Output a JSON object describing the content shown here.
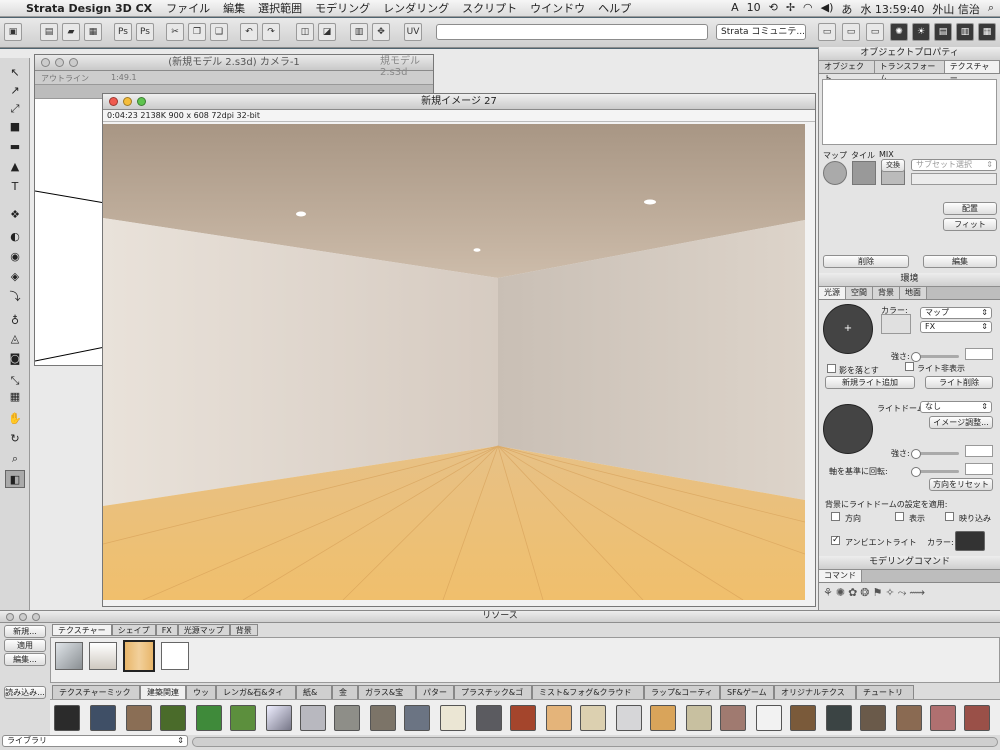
{
  "menubar": {
    "app_name": "Strata Design 3D CX",
    "items": [
      "ファイル",
      "編集",
      "選択範囲",
      "モデリング",
      "レンダリング",
      "スクリプト",
      "ウインドウ",
      "ヘルプ"
    ],
    "status_a": "10",
    "clock": "水 13:59:40",
    "user": "外山 信治"
  },
  "toolbar": {
    "community_label": "Strata コミュニテ..."
  },
  "model_window": {
    "title": "(新規モデル 2.s3d) カメラ-1",
    "behind_title": "規モデル 2.s3d",
    "outline_label": "アウトライン",
    "scale_label": "1:49.1"
  },
  "render_window": {
    "title": "新規イメージ 27",
    "info": "0:04:23   2138K   900 x 608   72dpi   32-bit"
  },
  "object_props": {
    "title": "オブジェクトプロパティ",
    "tabs": [
      "オブジェクト",
      "トランスフォーム",
      "テクスチャー"
    ],
    "labels": [
      "マップ",
      "タイル",
      "MIX"
    ],
    "swap_label": "交換",
    "subset_placeholder": "サブセット選択",
    "place_button": "配置",
    "fit_button": "フィット",
    "delete_button": "削除",
    "edit_button": "編集"
  },
  "environment": {
    "title": "環境",
    "tabs": [
      "光源",
      "空間",
      "背景",
      "地面"
    ],
    "color_label": "カラー:",
    "map_dropdown": "マップ",
    "fx_dropdown": "FX",
    "strength_label": "強さ:",
    "shadow_label": "影を落とす",
    "hide_light_label": "ライト非表示",
    "new_light_button": "新規ライト追加",
    "delete_light_button": "ライト削除",
    "light_dome_label": "ライトドーム:",
    "light_dome_value": "なし",
    "image_adjust_button": "イメージ調整...",
    "strength2_label": "強さ:",
    "rotate_label": "軸を基準に回転:",
    "reset_direction_button": "方向をリセット",
    "apply_bg_label": "背景にライトドームの設定を適用:",
    "direction_label": "方向",
    "display_label": "表示",
    "reflect_label": "映り込み",
    "ambient_label": "アンビエントライト",
    "ambient_color_label": "カラー:"
  },
  "modeling_commands": {
    "title": "モデリングコマンド",
    "tab": "コマンド"
  },
  "resources": {
    "title": "リソース",
    "buttons": [
      "新規...",
      "適用",
      "編集..."
    ],
    "load_button": "読み込み...",
    "library_dropdown": "ライブラリ",
    "top_tabs": [
      "テクスチャー",
      "シェイプ",
      "FX",
      "光源マップ",
      "背景"
    ],
    "categories": [
      "テクスチャーミックス",
      "建築関連",
      "ウッド",
      "レンガ&石&タイル",
      "紙&布",
      "金属",
      "ガラス&宝石",
      "パターン",
      "プラスチック&ゴム",
      "ミスト&フォグ&クラウド&空間",
      "ラップ&コーティング",
      "SF&ゲーム",
      "オリジナルテクスチャ",
      "チュートリアル"
    ]
  },
  "colors": {
    "ambient_swatch": "#333333",
    "ceiling": "#c9b9a6",
    "wall": "#d8d2cb",
    "floor": "#e8b66a"
  }
}
